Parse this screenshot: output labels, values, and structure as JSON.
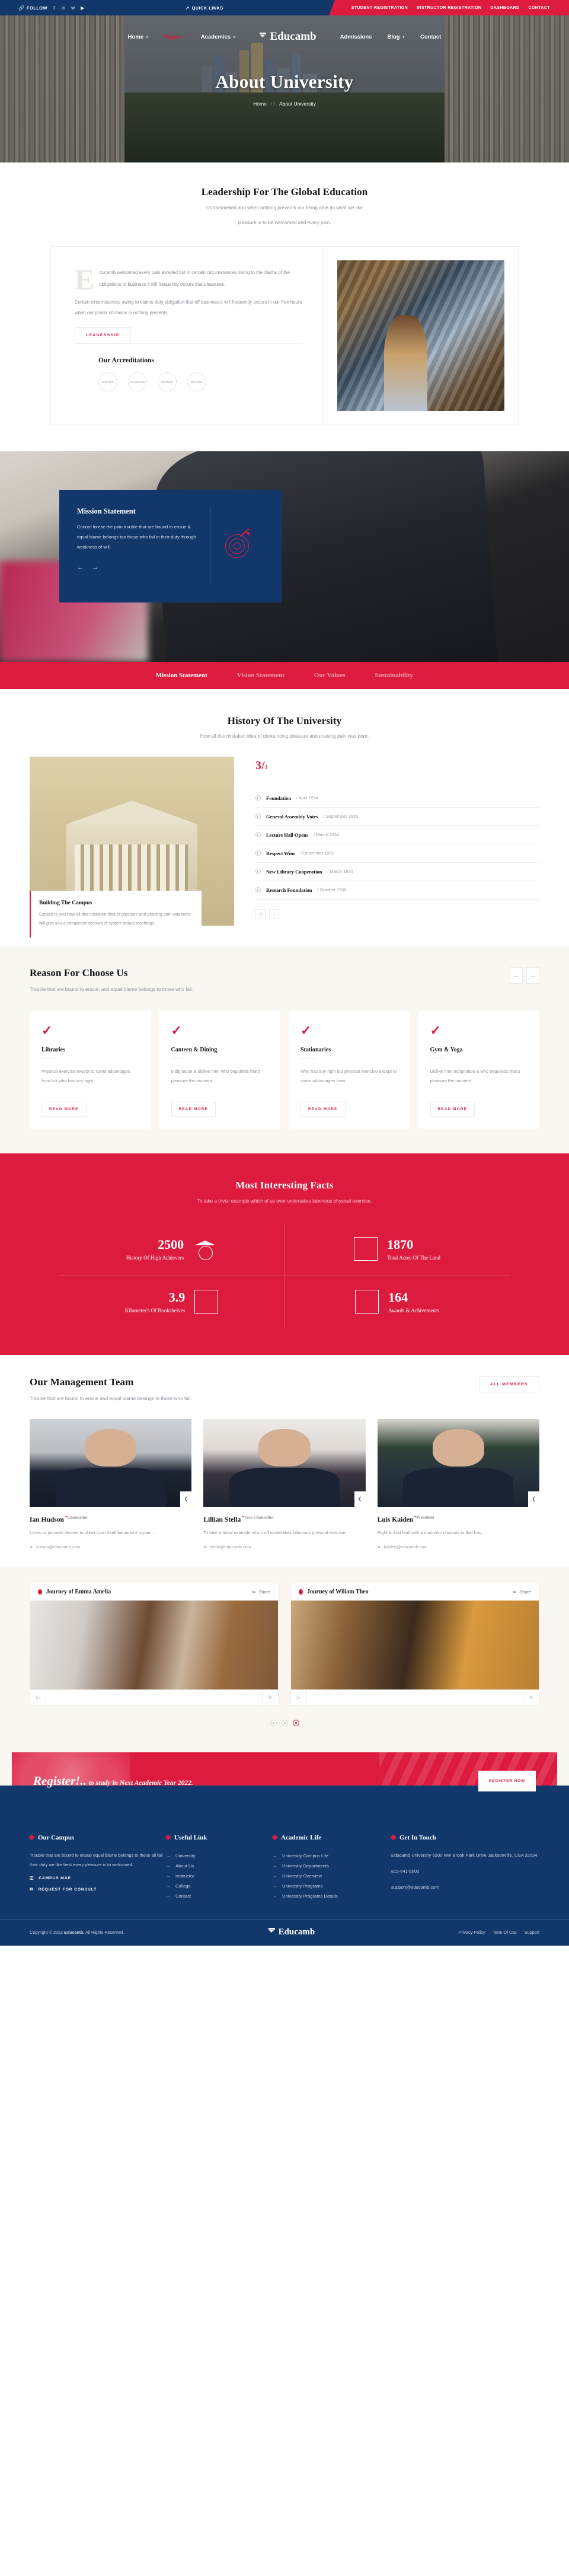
{
  "topbar": {
    "follow_label": "FOLLOW",
    "social_icons": [
      "facebook-icon",
      "linkedin-icon",
      "twitter-icon",
      "youtube-icon"
    ],
    "quick_links_label": "QUICK LINKS",
    "right_links": [
      "STUDENT REGISTRATION",
      "INSTRUCTOR REGISTRATION",
      "DASHBOARD",
      "CONTACT"
    ]
  },
  "nav": {
    "brand": "Educamb",
    "left_items": [
      {
        "label": "Home",
        "caret": "∨",
        "active": false
      },
      {
        "label": "Pages",
        "caret": "∧",
        "active": true
      },
      {
        "label": "Academics",
        "caret": "∨",
        "active": false
      }
    ],
    "right_items": [
      {
        "label": "Admissions",
        "caret": "",
        "active": false
      },
      {
        "label": "Blog",
        "caret": "∨",
        "active": false
      },
      {
        "label": "Contact",
        "caret": "",
        "active": false
      }
    ]
  },
  "hero": {
    "title": "About University",
    "breadcrumb_home": "Home",
    "breadcrumb_sep": "/ /",
    "breadcrumb_current": "About University"
  },
  "leadership": {
    "title": "Leadership For The Global Education",
    "subtitle_line1": "Untrammelled and when nothing prevents our being able do what we like",
    "subtitle_line2": "pleasure is to be welcomed and every pain.",
    "dropcap": "E",
    "paragraph1": "ducamb welcomed every pain avoided but in certain circumstances owing to the claims of the obligations of business it will frequently occurs that pleasures.",
    "paragraph2": "Certain circumstances owing to claims duty obligation that off business it will frequently occurs in our free hours when our power of choice is nothing prevents.",
    "button_label": "LEADERSHIP",
    "accreditations_title": "Our Accreditations",
    "badges": [
      "WINNER",
      "CHAMPION",
      "WINNER",
      "WINNER"
    ]
  },
  "mission": {
    "card_title": "Mission Statement",
    "card_text": "Cannot forese the pain trouble that are bound to ensue & equal blame belongs too those who fail in their duty through weakness of will.",
    "prev_arrow": "←",
    "next_arrow": "→",
    "tabs": [
      {
        "label": "Mission Statement",
        "active": true
      },
      {
        "label": "Vision Statement",
        "active": false
      },
      {
        "label": "Our Values",
        "active": false
      },
      {
        "label": "Sustainability",
        "active": false
      }
    ]
  },
  "history": {
    "title": "History Of The University",
    "subtitle": "How all this mistaken idea of denouncing pleasure and praising pain was born.",
    "counter_current": "3/",
    "counter_total": "3",
    "caption_title": "Building The Campus",
    "caption_text": "Explain to you how all this mistaken idea of pleasure and praising pain was born will give you a completed account of system actual teachings.",
    "items": [
      {
        "name": "Foundation",
        "date": "/ April 1934"
      },
      {
        "name": "General Assembly Votes",
        "date": "/ September 1935"
      },
      {
        "name": "Lecture Hall Opens",
        "date": "/ March 1944"
      },
      {
        "name": "Respect Wins",
        "date": "/ December 1951"
      },
      {
        "name": "New Library Cooperation",
        "date": "/ March 1950"
      },
      {
        "name": "Research Foundation",
        "date": "/ October 1946"
      }
    ],
    "nav_up": "↑",
    "nav_down": "↓"
  },
  "reason": {
    "title": "Reason For Choose Us",
    "subtitle": "Trouble that are bound to ensue; and equal blame belongs to those who fail.",
    "prev_arrow": "←",
    "next_arrow": "→",
    "cards": [
      {
        "title": "Libraries",
        "text": "Physical exercise except to some advantages from but who has any right.",
        "button": "READ MORE",
        "icon": "check-icon"
      },
      {
        "title": "Canteen & Dining",
        "text": "Indignation & dislike men who beguileds that's pleasure the moment.",
        "button": "READ MORE",
        "icon": "check-icon"
      },
      {
        "title": "Stationaries",
        "text": "Who has any right but physical exercise except to some advantages from.",
        "button": "READ MORE",
        "icon": "check-icon"
      },
      {
        "title": "Gym & Yoga",
        "text": "Dislike men indignation & who beguileds that's pleasure the moment.",
        "button": "READ MORE",
        "icon": "check-icon"
      }
    ]
  },
  "facts": {
    "title": "Most Interesting Facts",
    "subtitle": "To take a trivial example which of us ever undertakes laborious physical exercise.",
    "items": [
      {
        "number": "2500",
        "label": "History Of High Achievers",
        "icon": "graduation-globe-icon"
      },
      {
        "number": "1870",
        "label": "Total Acres Of The Land",
        "icon": "building-icon"
      },
      {
        "number": "3.9",
        "label": "Kilometer's Of Bookshelves",
        "icon": "open-book-icon"
      },
      {
        "number": "164",
        "label": "Awards & Achivements",
        "icon": "trophy-icon"
      }
    ]
  },
  "team": {
    "title": "Our Management Team",
    "subtitle": "Trouble that are bound to ensue and equal blame belongs to those who fail.",
    "all_members_label": "ALL MEMBERS",
    "members": [
      {
        "name": "Ian Hudson",
        "role": "Chancellor",
        "desc": "Loves or pursues desires to obtain pain itself because it is pain...",
        "email": "hutson@educamb.com",
        "share_icon": "share-icon"
      },
      {
        "name": "Lillian Stella",
        "role": "Vice Chancellor",
        "desc": "To take a trivial example which off undertakes laborious physical exercise.",
        "email": "stella@educamb.com",
        "share_icon": "share-icon"
      },
      {
        "name": "Luis Kaiden",
        "role": "President",
        "desc": "Right to find fault with a man who chooses to that has...",
        "email": "kaiden@educamb.com",
        "share_icon": "share-icon"
      }
    ]
  },
  "journey": {
    "cards": [
      {
        "title": "Journey of Emma Amelia",
        "share_label": "Share",
        "play_icon": "play-icon",
        "reload_icon": "reload-icon"
      },
      {
        "title": "Journey of Wiliam Theo",
        "share_label": "Share",
        "play_icon": "play-icon",
        "reload_icon": "reload-icon"
      }
    ],
    "dots": [
      false,
      false,
      true
    ]
  },
  "register": {
    "headline_bold": "Register!..",
    "headline_rest": "to study in Next Academic Year 2022.",
    "button_label": "REGISTER NOW"
  },
  "footer": {
    "campus": {
      "heading": "Our Campus",
      "text": "Trouble that are bound to ensue equal blame belongs to those all fail their duty we like best every pleasure is to welcomed.",
      "actions": [
        {
          "label": "CAMPUS MAP",
          "icon": "map-icon"
        },
        {
          "label": "REQUEST FOR CONSULT",
          "icon": "chat-icon"
        }
      ]
    },
    "useful": {
      "heading": "Useful Link",
      "links": [
        "University",
        "About Us",
        "Instructor",
        "College",
        "Contact"
      ]
    },
    "academic": {
      "heading": "Academic Life",
      "links": [
        "University Campus Life",
        "University Departments",
        "University Overview",
        "University Programs",
        "University Programs Details"
      ]
    },
    "touch": {
      "heading": "Get In Touch",
      "address": "Educamb University 6500 NW Brook Park Drive Jacksonville, USA 32034.",
      "phone": "815-641-5000",
      "email": "support@educamb.com"
    },
    "bottom": {
      "copyright_pre": "Copyright © 2022 ",
      "copyright_brand": "Educamb.",
      "copyright_post": " All Rights Reserved.",
      "logo": "Educamb",
      "links": [
        "Privacy Policy",
        "Term Of Use",
        "Support"
      ]
    }
  },
  "colors": {
    "primary_red": "#dd1b3f",
    "navy": "#12386b",
    "cream": "#faf7f3"
  }
}
